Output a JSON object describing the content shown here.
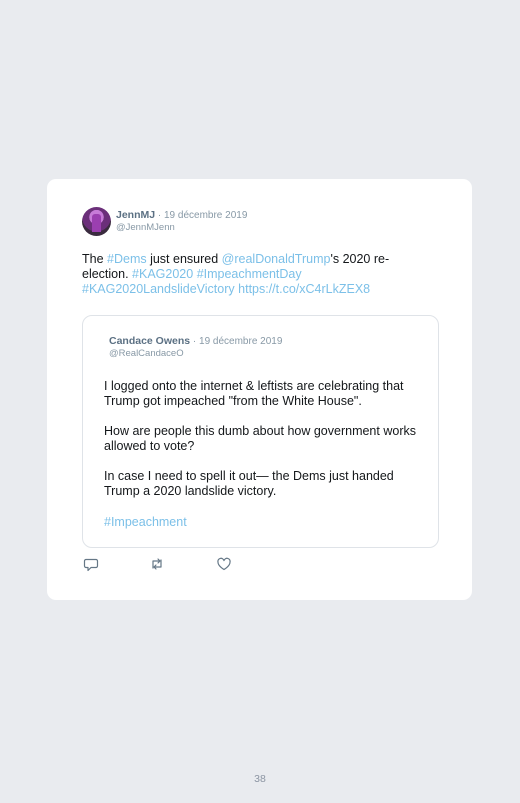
{
  "tweet": {
    "name": "JennMJ",
    "date": " · 19 décembre 2019",
    "handle": "@JennMJenn",
    "text_parts": {
      "p1": "The ",
      "l1": "#Dems",
      "p2": " just ensured ",
      "l2": "@realDonaldTrump",
      "p3": "'s 2020 re-election. ",
      "l3": "#KAG2020",
      "p4": " ",
      "l4": "#ImpeachmentDay",
      "p5": " ",
      "l5": "#KAG2020LandslideVictory",
      "p6": " ",
      "l6": "https://t.co/xC4rLkZEX8"
    }
  },
  "quote": {
    "name": "Candace Owens",
    "date": " · 19 décembre 2019",
    "handle": "@RealCandaceO",
    "para1": "I logged onto the internet & leftists are celebrating that Trump got impeached \"from the White House\".",
    "para2": "How are people this dumb about how government works allowed to vote?",
    "para3": "In case I need to spell it out— the Dems just handed Trump a 2020 landslide victory.",
    "hashtag": "#Impeachment"
  },
  "actions": [
    "reply-icon",
    "retweet-icon",
    "like-icon"
  ],
  "page_number": "38",
  "colors": {
    "link": "#7cc0e8",
    "background": "#e9ebef",
    "card": "#ffffff"
  }
}
